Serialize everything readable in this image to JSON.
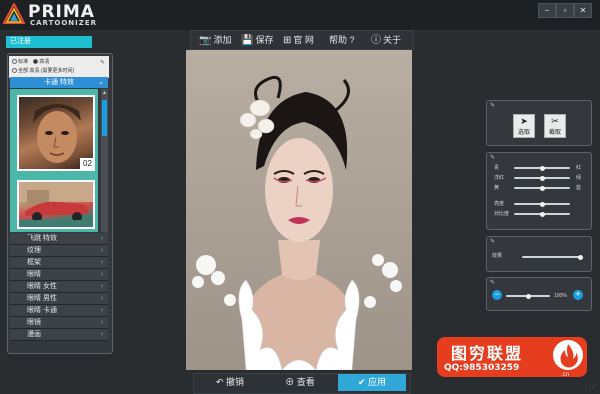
{
  "app": {
    "logo_line1": "PRIMA",
    "logo_line2": "CARTOONIZER",
    "window_buttons": [
      "−",
      "▫",
      "✕"
    ]
  },
  "toolbar": {
    "add_label": "添加",
    "save_label": "保存",
    "website_label": "官 网",
    "help_label": "帮助",
    "help_mark": "?",
    "about_label": "关于"
  },
  "left": {
    "registered_tab": "已注册",
    "quality": {
      "standard": "标准",
      "hd": "高清",
      "full_hd": "全部 高清 (需要更多时间)"
    },
    "effect_dropdown": "卡通 特效",
    "thumbnail_number": "02",
    "menu": [
      "飞跳 特效",
      "纹理",
      "框架",
      "眼睛",
      "眼睛 女性",
      "眼睛 男性",
      "眼睛 卡通",
      "眼镜",
      "漫画"
    ]
  },
  "bottom": {
    "undo_label": "撤销",
    "view_label": "查看",
    "apply_label": "应用"
  },
  "right": {
    "select_label": "选取",
    "crop_label": "截取",
    "color": {
      "cyan": "青",
      "red": "红",
      "magenta": "洋红",
      "green": "绿",
      "yellow": "黄",
      "blue": "蓝",
      "brightness": "亮度",
      "contrast": "对比度"
    },
    "effect_label": "效果",
    "zoom_value": "100%"
  },
  "levels": {
    "cyan_red": 0.5,
    "magenta_green": 0.5,
    "yellow_blue": 0.5,
    "brightness": 0.5,
    "contrast": 0.5,
    "effect": 0.97,
    "zoom": 0.5
  },
  "watermark": {
    "title": "图穷联盟",
    "qq": "QQ:985303259",
    "tail": ".cn"
  },
  "colors": {
    "accent_blue": "#2e8fd6",
    "registered_cyan": "#1dbfd0",
    "apply_green": "#2fa7d7",
    "watermark_red": "#e73d1f"
  }
}
